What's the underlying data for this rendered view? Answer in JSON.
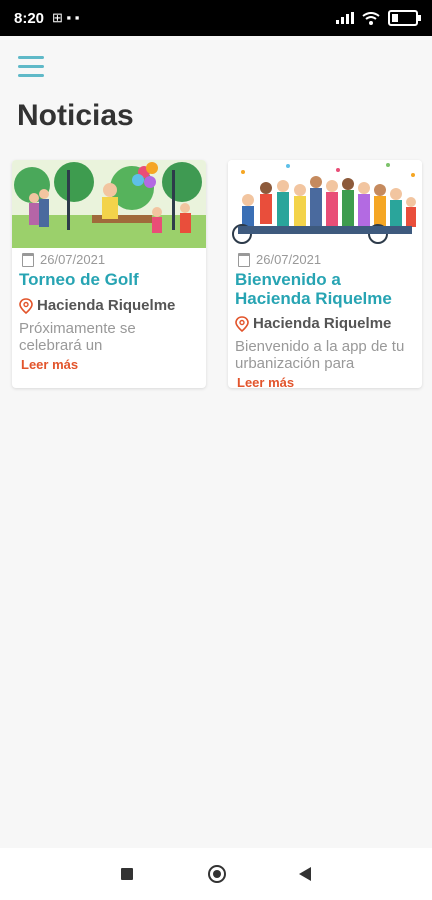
{
  "status": {
    "time": "8:20",
    "left_icons": "⊞ ▪ ▪"
  },
  "header": {
    "title": "Noticias",
    "menu_icon": "hamburger-icon"
  },
  "news": [
    {
      "date": "26/07/2021",
      "title": "Torneo de Golf",
      "location": "Hacienda Riquelme",
      "excerpt": "Próximamente se celebrará un",
      "more": "Leer más"
    },
    {
      "date": "26/07/2021",
      "title": "Bienvenido a Hacienda Riquelme",
      "location": "Hacienda Riquelme",
      "excerpt": "Bienvenido a la app de tu urbanización para",
      "more": "Leer más"
    }
  ],
  "colors": {
    "accent": "#27a4b3",
    "link": "#e2542b",
    "menu": "#5fb9c8"
  }
}
